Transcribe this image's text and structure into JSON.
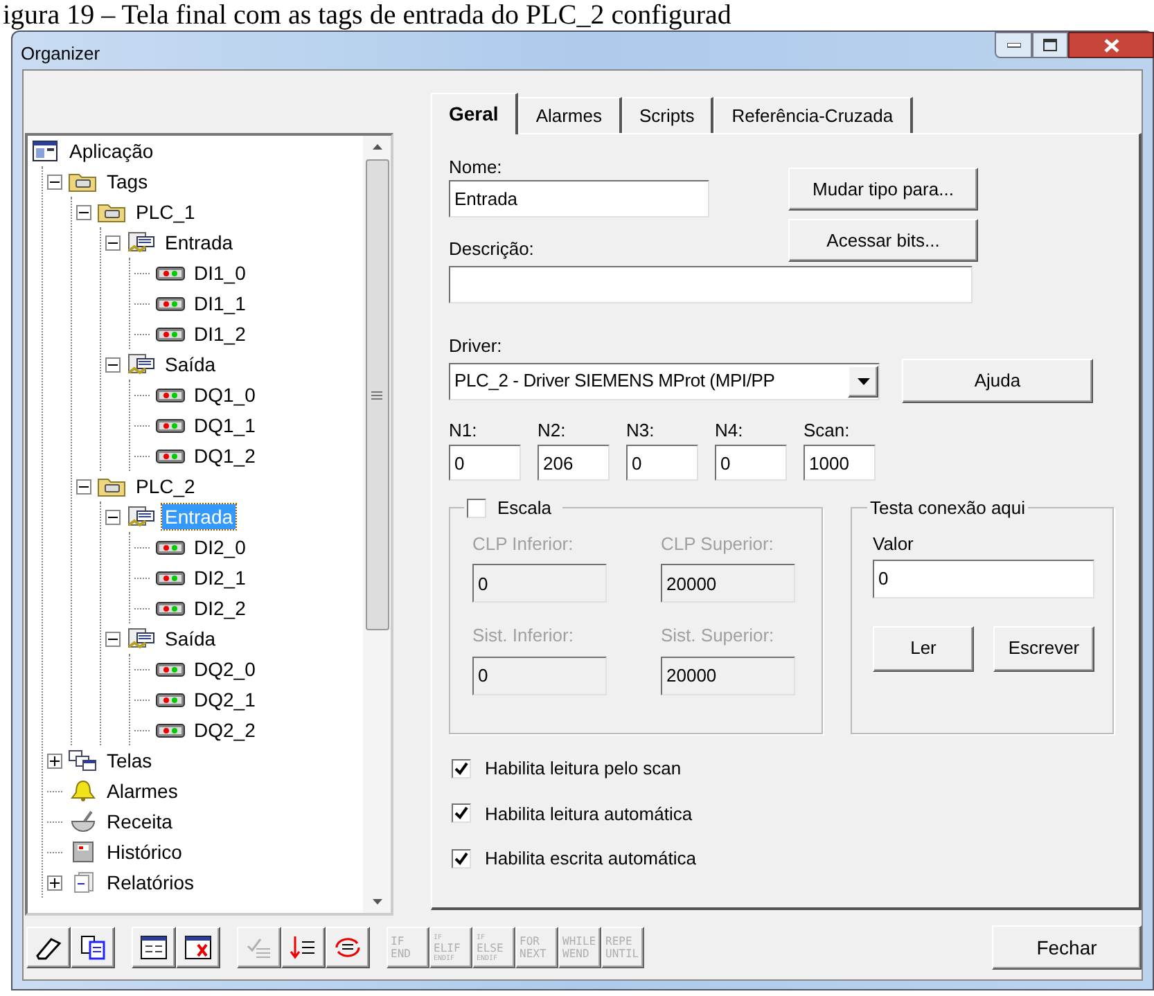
{
  "caption": "igura 19 – Tela final com as tags de entrada do PLC_2 configurad",
  "window": {
    "title": "Organizer"
  },
  "tree": [
    {
      "label": "Aplicação",
      "kind": "app",
      "selected": false,
      "children": [
        {
          "label": "Tags",
          "kind": "folder",
          "expanded": true,
          "selected": false,
          "children": [
            {
              "label": "PLC_1",
              "kind": "folder",
              "expanded": true,
              "selected": false,
              "children": [
                {
                  "label": "Entrada",
                  "kind": "group",
                  "expanded": true,
                  "selected": false,
                  "children": [
                    {
                      "label": "DI1_0",
                      "kind": "tag",
                      "selected": false
                    },
                    {
                      "label": "DI1_1",
                      "kind": "tag",
                      "selected": false
                    },
                    {
                      "label": "DI1_2",
                      "kind": "tag",
                      "selected": false
                    }
                  ]
                },
                {
                  "label": "Saída",
                  "kind": "group",
                  "expanded": true,
                  "selected": false,
                  "children": [
                    {
                      "label": "DQ1_0",
                      "kind": "tag",
                      "selected": false
                    },
                    {
                      "label": "DQ1_1",
                      "kind": "tag",
                      "selected": false
                    },
                    {
                      "label": "DQ1_2",
                      "kind": "tag",
                      "selected": false
                    }
                  ]
                }
              ]
            },
            {
              "label": "PLC_2",
              "kind": "folder",
              "expanded": true,
              "selected": false,
              "children": [
                {
                  "label": "Entrada",
                  "kind": "group",
                  "expanded": true,
                  "selected": true,
                  "children": [
                    {
                      "label": "DI2_0",
                      "kind": "tag",
                      "selected": false
                    },
                    {
                      "label": "DI2_1",
                      "kind": "tag",
                      "selected": false
                    },
                    {
                      "label": "DI2_2",
                      "kind": "tag",
                      "selected": false
                    }
                  ]
                },
                {
                  "label": "Saída",
                  "kind": "group",
                  "expanded": true,
                  "selected": false,
                  "children": [
                    {
                      "label": "DQ2_0",
                      "kind": "tag",
                      "selected": false
                    },
                    {
                      "label": "DQ2_1",
                      "kind": "tag",
                      "selected": false
                    },
                    {
                      "label": "DQ2_2",
                      "kind": "tag",
                      "selected": false
                    }
                  ]
                }
              ]
            }
          ]
        },
        {
          "label": "Telas",
          "kind": "screens",
          "expanded": false,
          "selected": false
        },
        {
          "label": "Alarmes",
          "kind": "alarm",
          "selected": false
        },
        {
          "label": "Receita",
          "kind": "recipe",
          "selected": false
        },
        {
          "label": "Histórico",
          "kind": "history",
          "selected": false
        },
        {
          "label": "Relatórios",
          "kind": "reports",
          "expanded": false,
          "selected": false
        }
      ]
    }
  ],
  "tabs": [
    {
      "label": "Geral",
      "selected": true
    },
    {
      "label": "Alarmes",
      "selected": false
    },
    {
      "label": "Scripts",
      "selected": false
    },
    {
      "label": "Referência-Cruzada",
      "selected": false
    }
  ],
  "name": {
    "label": "Nome:",
    "value": "Entrada"
  },
  "change_type_button": "Mudar tipo para...",
  "bits_button": "Acessar bits...",
  "description": {
    "label": "Descrição:"
  },
  "driver": {
    "label": "Driver:",
    "value": "PLC_2 - Driver SIEMENS MProt (MPI/PP"
  },
  "help_button": "Ajuda",
  "addresses": [
    {
      "label": "N1:",
      "value": "0"
    },
    {
      "label": "N2:",
      "value": "206"
    },
    {
      "label": "N3:",
      "value": "0"
    },
    {
      "label": "N4:",
      "value": "0"
    },
    {
      "label": "Scan:",
      "value": "1000"
    }
  ],
  "scale": {
    "label": "Escala",
    "checked": false,
    "fields": [
      {
        "label": "CLP Inferior:",
        "value": "0",
        "disabled": true
      },
      {
        "label": "CLP Superior:",
        "value": "20000",
        "disabled": true
      },
      {
        "label": "Sist. Inferior:",
        "value": "0",
        "disabled": true
      },
      {
        "label": "Sist. Superior:",
        "value": "20000",
        "disabled": true
      }
    ]
  },
  "test": {
    "title": "Testa conexão aqui",
    "label": "Valor",
    "value": "0",
    "buttons": [
      "Ler",
      "Escrever"
    ]
  },
  "options": [
    {
      "label": "Habilita leitura pelo scan",
      "checked": true
    },
    {
      "label": "Habilita leitura automática",
      "checked": true
    },
    {
      "label": "Habilita escrita automática",
      "checked": true
    }
  ],
  "toolbar": [
    [
      {
        "kind": "eraser",
        "disabled": false
      },
      {
        "kind": "copy",
        "disabled": false
      }
    ],
    [
      {
        "kind": "table",
        "disabled": false
      },
      {
        "kind": "table-delete",
        "disabled": false
      }
    ],
    [
      {
        "kind": "checklist",
        "disabled": true
      },
      {
        "kind": "sort",
        "disabled": false
      },
      {
        "kind": "refresh",
        "disabled": false
      }
    ]
  ],
  "script_buttons": [
    {
      "lines": [
        "IF",
        "END"
      ],
      "disabled": true
    },
    {
      "lines": [
        "IF",
        "ELIF",
        "ENDIF"
      ],
      "disabled": true
    },
    {
      "lines": [
        "IF",
        "ELSE",
        "ENDIF"
      ],
      "disabled": true
    },
    {
      "lines": [
        "FOR",
        "NEXT"
      ],
      "disabled": true
    },
    {
      "lines": [
        "WHILE",
        "WEND"
      ],
      "disabled": true
    },
    {
      "lines": [
        "REPE",
        "UNTIL"
      ],
      "disabled": true
    }
  ],
  "close_button": "Fechar"
}
